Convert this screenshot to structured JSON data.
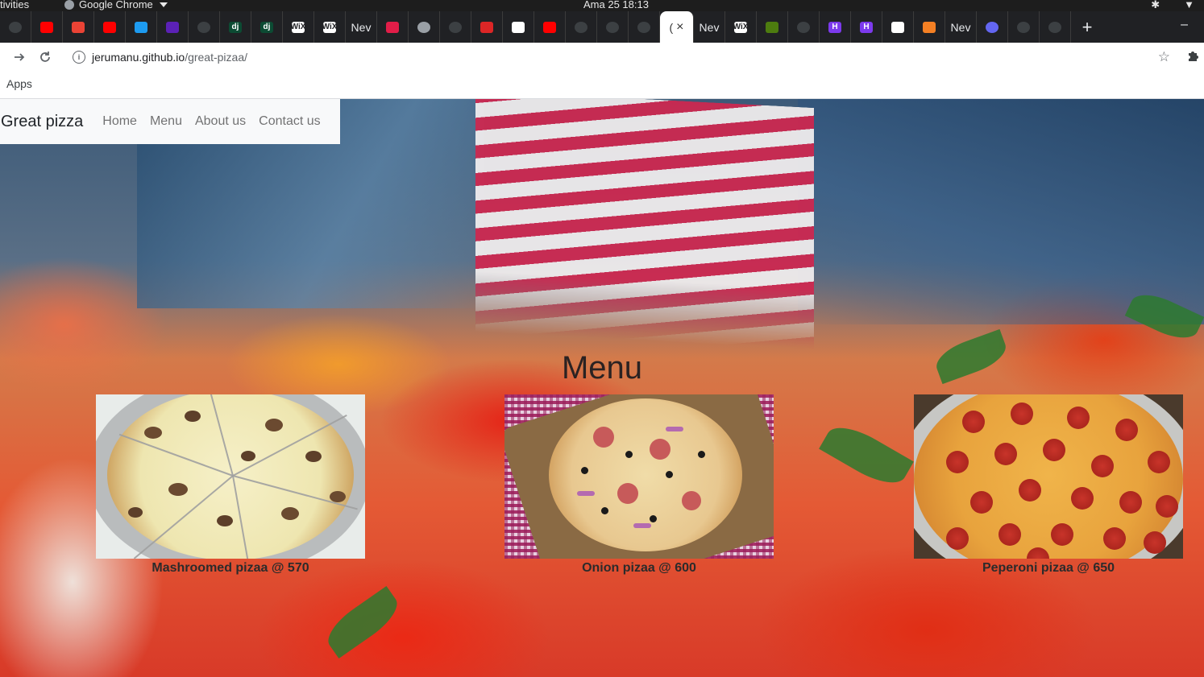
{
  "os": {
    "activities": "tivities",
    "app_name": "Google Chrome",
    "clock": "Ama 25  18:13"
  },
  "tabs": [
    {
      "icon": "generic-icon",
      "color": "#3c4043"
    },
    {
      "icon": "youtube-icon",
      "color": "#ff0000"
    },
    {
      "icon": "gmail-icon",
      "color": "#ea4335"
    },
    {
      "icon": "youtube-icon",
      "color": "#ff0000"
    },
    {
      "icon": "twitter-icon",
      "color": "#1d9bf0"
    },
    {
      "icon": "h-icon",
      "color": "#5b21b6"
    },
    {
      "icon": "generic-icon",
      "color": "#3c4043"
    },
    {
      "icon": "django-icon",
      "color": "#0c4b33",
      "text": "dj"
    },
    {
      "icon": "django-icon",
      "color": "#0c4b33",
      "text": "dj"
    },
    {
      "icon": "wix-icon",
      "color": "#ffffff",
      "text": "WiX"
    },
    {
      "icon": "wix-icon",
      "color": "#ffffff",
      "text": "WiX"
    },
    {
      "icon": "text-tab",
      "text": "Nev"
    },
    {
      "icon": "u-icon",
      "color": "#e11d48"
    },
    {
      "icon": "globe-icon",
      "color": "#9aa0a6"
    },
    {
      "icon": "generic-icon",
      "color": "#3c4043"
    },
    {
      "icon": "check-icon",
      "color": "#dc2626"
    },
    {
      "icon": "free-icon",
      "color": "#ffffff"
    },
    {
      "icon": "youtube-icon",
      "color": "#ff0000"
    },
    {
      "icon": "generic-icon",
      "color": "#3c4043"
    },
    {
      "icon": "generic-icon",
      "color": "#3c4043"
    },
    {
      "icon": "github-icon",
      "color": "#3c4043"
    }
  ],
  "active_tab": {
    "label": "(",
    "close": "×"
  },
  "tabs_right": [
    {
      "icon": "text-tab",
      "text": "Nev"
    },
    {
      "icon": "wix-icon",
      "color": "#ffffff",
      "text": "WiX"
    },
    {
      "icon": "tree-icon",
      "color": "#4d7c0f"
    },
    {
      "icon": "github-icon",
      "color": "#3c4043"
    },
    {
      "icon": "h-icon",
      "color": "#7c3aed",
      "text": "H"
    },
    {
      "icon": "h-icon",
      "color": "#7c3aed",
      "text": "H"
    },
    {
      "icon": "hex-icon",
      "color": "#ffffff"
    },
    {
      "icon": "stack-icon",
      "color": "#f48024"
    },
    {
      "icon": "text-tab",
      "text": "Nev"
    },
    {
      "icon": "avatar-icon",
      "color": "#6366f1"
    },
    {
      "icon": "generic-icon",
      "color": "#3c4043"
    },
    {
      "icon": "generic-icon",
      "color": "#3c4043"
    }
  ],
  "toolbar": {
    "url_host": "jerumanu.github.io",
    "url_path": "/great-pizaa/"
  },
  "bookmarks": {
    "apps": "Apps"
  },
  "site": {
    "brand": "Great pizza",
    "nav": [
      "Home",
      "Menu",
      "About us",
      "Contact us"
    ],
    "menu_heading": "Menu",
    "items": [
      {
        "caption": "Mashroomed pizaa @ 570",
        "kind": "mushroom"
      },
      {
        "caption": "Onion pizaa @ 600",
        "kind": "onion"
      },
      {
        "caption": "Peperoni pizaa @ 650",
        "kind": "pepperoni"
      }
    ]
  }
}
